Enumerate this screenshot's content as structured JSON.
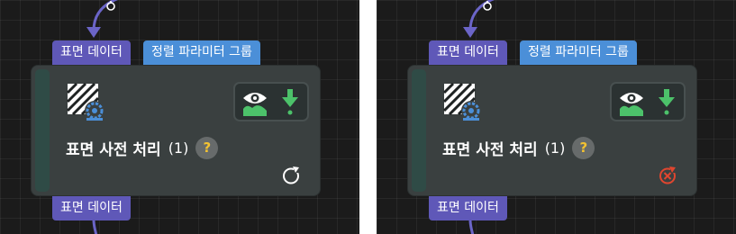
{
  "nodes": [
    {
      "input_port_label": "표면 데이터",
      "param_group_label": "정렬 파라미터 그룹",
      "title": "표면 사전 처리",
      "count": "(1)",
      "help": "?",
      "output_port_label": "표면 데이터",
      "status_icon": "refresh-icon"
    },
    {
      "input_port_label": "표면 데이터",
      "param_group_label": "정렬 파라미터 그룹",
      "title": "표면 사전 처리",
      "count": "(1)",
      "help": "?",
      "output_port_label": "표면 데이터",
      "status_icon": "error-icon"
    }
  ],
  "colors": {
    "canvas_background": "#1b1b1b",
    "port_tag": "#5f58b8",
    "param_group_tag": "#4b8fd8",
    "wire": "#6b65c8",
    "card_background": "#3a4040",
    "view_icon_green": "#4cc26a",
    "help_question": "#f2c232",
    "error_red": "#e0462f"
  }
}
